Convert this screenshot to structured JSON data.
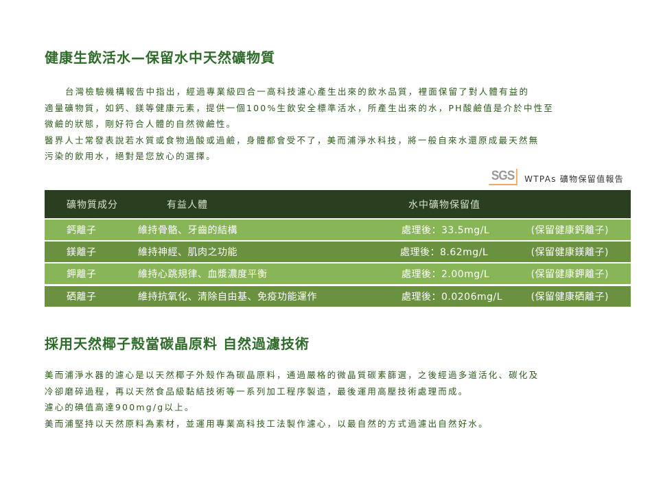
{
  "section1": {
    "title": "健康生飲活水—保留水中天然礦物質",
    "lines": [
      "台灣檢驗機構報告中指出，經過專業級四合一高科技濾心產生出來的飲水品質，裡面保留了對人體有益的",
      "適量礦物質，如鈣、鎂等健康元素，提供一個100%生飲安全標準活水，所產生出來的水，PH酸鹼值是介於中性至",
      "微鹼的狀態，剛好符合人體的自然微鹼性。",
      "醫界人士常發表說若水質或食物過酸或過鹼，身體都會受不了，美而浦淨水科技，將一般自來水還原成最天然無",
      "污染的飲用水，絕對是您放心的選擇。"
    ]
  },
  "sgs": {
    "logo": "SGS",
    "label": "WTPAs 礦物保留值報告"
  },
  "table": {
    "headers": [
      "礦物質成分",
      "有益人體",
      "水中礦物保留值"
    ],
    "rows": [
      {
        "mineral": "鈣離子",
        "benefit": "維持骨骼、牙齒的結構",
        "value": "處理後：33.5mg/L",
        "note": "(保留健康鈣離子)"
      },
      {
        "mineral": "鎂離子",
        "benefit": "維持神經、肌肉之功能",
        "value": "處理後：8.62mg/L",
        "note": "(保留健康鎂離子)"
      },
      {
        "mineral": "鉀離子",
        "benefit": "維持心跳規律、血漿濃度平衡",
        "value": "處理後：2.00mg/L",
        "note": "(保留健康鉀離子)"
      },
      {
        "mineral": "硒離子",
        "benefit": "維持抗氧化、清除自由基、免疫功能運作",
        "value": "處理後：0.0206mg/L",
        "note": "(保留健康硒離子)"
      }
    ]
  },
  "section2": {
    "title": "採用天然椰子殼當碳晶原料 自然過濾技術",
    "lines": [
      "美而浦淨水器的濾心是以天然椰子外殼作為碳晶原料，通過嚴格的微晶質碳素篩選，之後經過多道活化、碳化及",
      "冷卻磨碎過程，再以天然食品級黏結技術等一系列加工程序製造，最後運用高壓技術處理而成。",
      "濾心的碘值高達900mg/g以上。",
      "美而浦堅持以天然原料為素材，並運用專業高科技工法製作濾心，以最自然的方式過濾出自然好水。"
    ]
  },
  "colors": {
    "heading": "#2f6b2a",
    "text": "#2d5a1c",
    "table_header": "#2a3f20",
    "row_light": "#88b557",
    "row_dark": "#6a9140"
  }
}
